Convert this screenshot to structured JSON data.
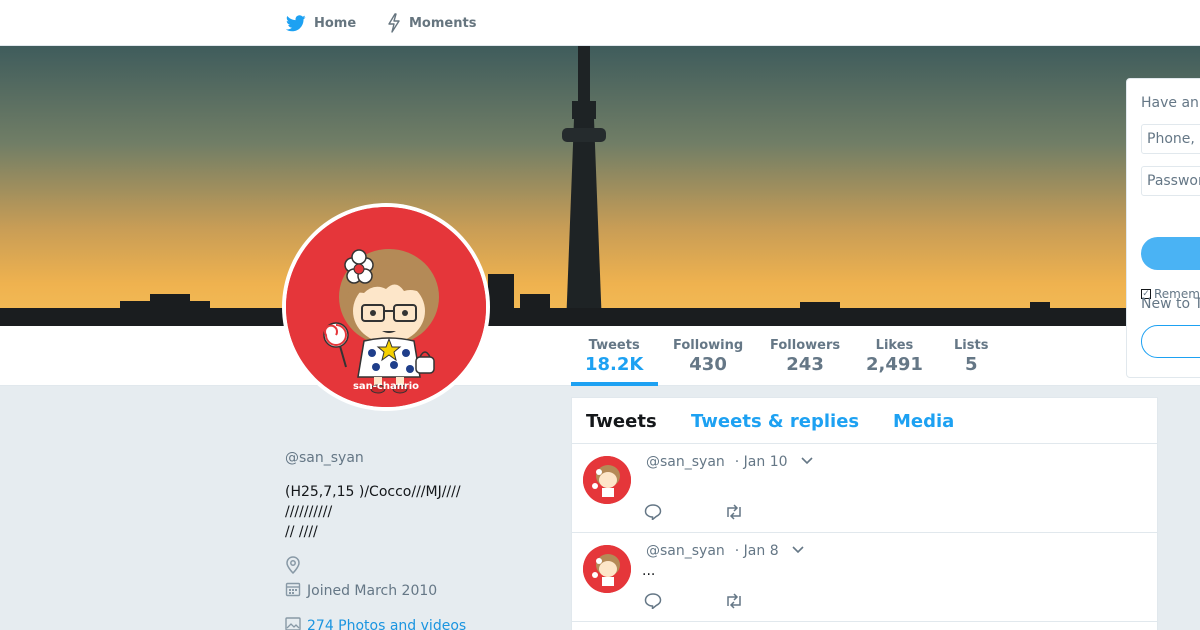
{
  "nav": {
    "home_label": "Home",
    "moments_label": "Moments"
  },
  "profile": {
    "handle": "@san_syan",
    "bio": "(H25,7,15 )/Cocco///MJ////\n//////////\n// ////",
    "joined": "Joined March 2010",
    "photos": "274 Photos and videos",
    "avatar_brand": "san-chanrio"
  },
  "stats": [
    {
      "label": "Tweets",
      "value": "18.2K"
    },
    {
      "label": "Following",
      "value": "430"
    },
    {
      "label": "Followers",
      "value": "243"
    },
    {
      "label": "Likes",
      "value": "2,491"
    },
    {
      "label": "Lists",
      "value": "5"
    }
  ],
  "timeline": {
    "tabs": [
      "Tweets",
      "Tweets & replies",
      "Media"
    ],
    "tweets": [
      {
        "handle": "@san_syan",
        "date": "· Jan 10",
        "text": ""
      },
      {
        "handle": "@san_syan",
        "date": "· Jan 8",
        "text": "..."
      }
    ]
  },
  "login": {
    "heading": "Have an",
    "phone_placeholder": "Phone, e",
    "password_placeholder": "Passwor",
    "remember_label": "Remem",
    "new_to_label": "New to T"
  },
  "colors": {
    "accent": "#1da1f2",
    "avatar_red": "#e5363a",
    "muted": "#657786"
  }
}
